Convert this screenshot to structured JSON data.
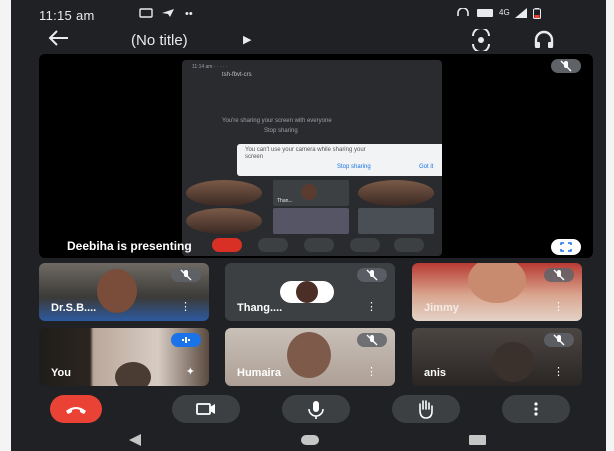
{
  "status_bar": {
    "time": "11:15 am",
    "network": "4G"
  },
  "top_bar": {
    "title": "(No title)"
  },
  "presentation": {
    "presenting_label": "Deebiha is presenting",
    "shared_screen": {
      "meeting_code": "tsh-fbvt-crs",
      "sharing_text": "You're sharing your screen with everyone",
      "stop_sharing_text": "Stop sharing",
      "dialog_text": "You can't use your camera while sharing your screen",
      "dialog_stop": "Stop sharing",
      "dialog_ok": "Got it",
      "thumb_name": "Than..."
    }
  },
  "participants": [
    {
      "name": "Dr.S.B....",
      "muted": true
    },
    {
      "name": "Thang....",
      "muted": true
    },
    {
      "name": "Jimmy",
      "muted": true
    },
    {
      "name": "You",
      "muted": false
    },
    {
      "name": "Humaira",
      "muted": true
    },
    {
      "name": "anis",
      "muted": true
    }
  ],
  "colors": {
    "background": "#202124",
    "end_call": "#ea4335",
    "control": "#3c4043",
    "accent_blue": "#1a73e8"
  },
  "controls": [
    "end-call",
    "camera",
    "microphone",
    "raise-hand",
    "more-options"
  ]
}
